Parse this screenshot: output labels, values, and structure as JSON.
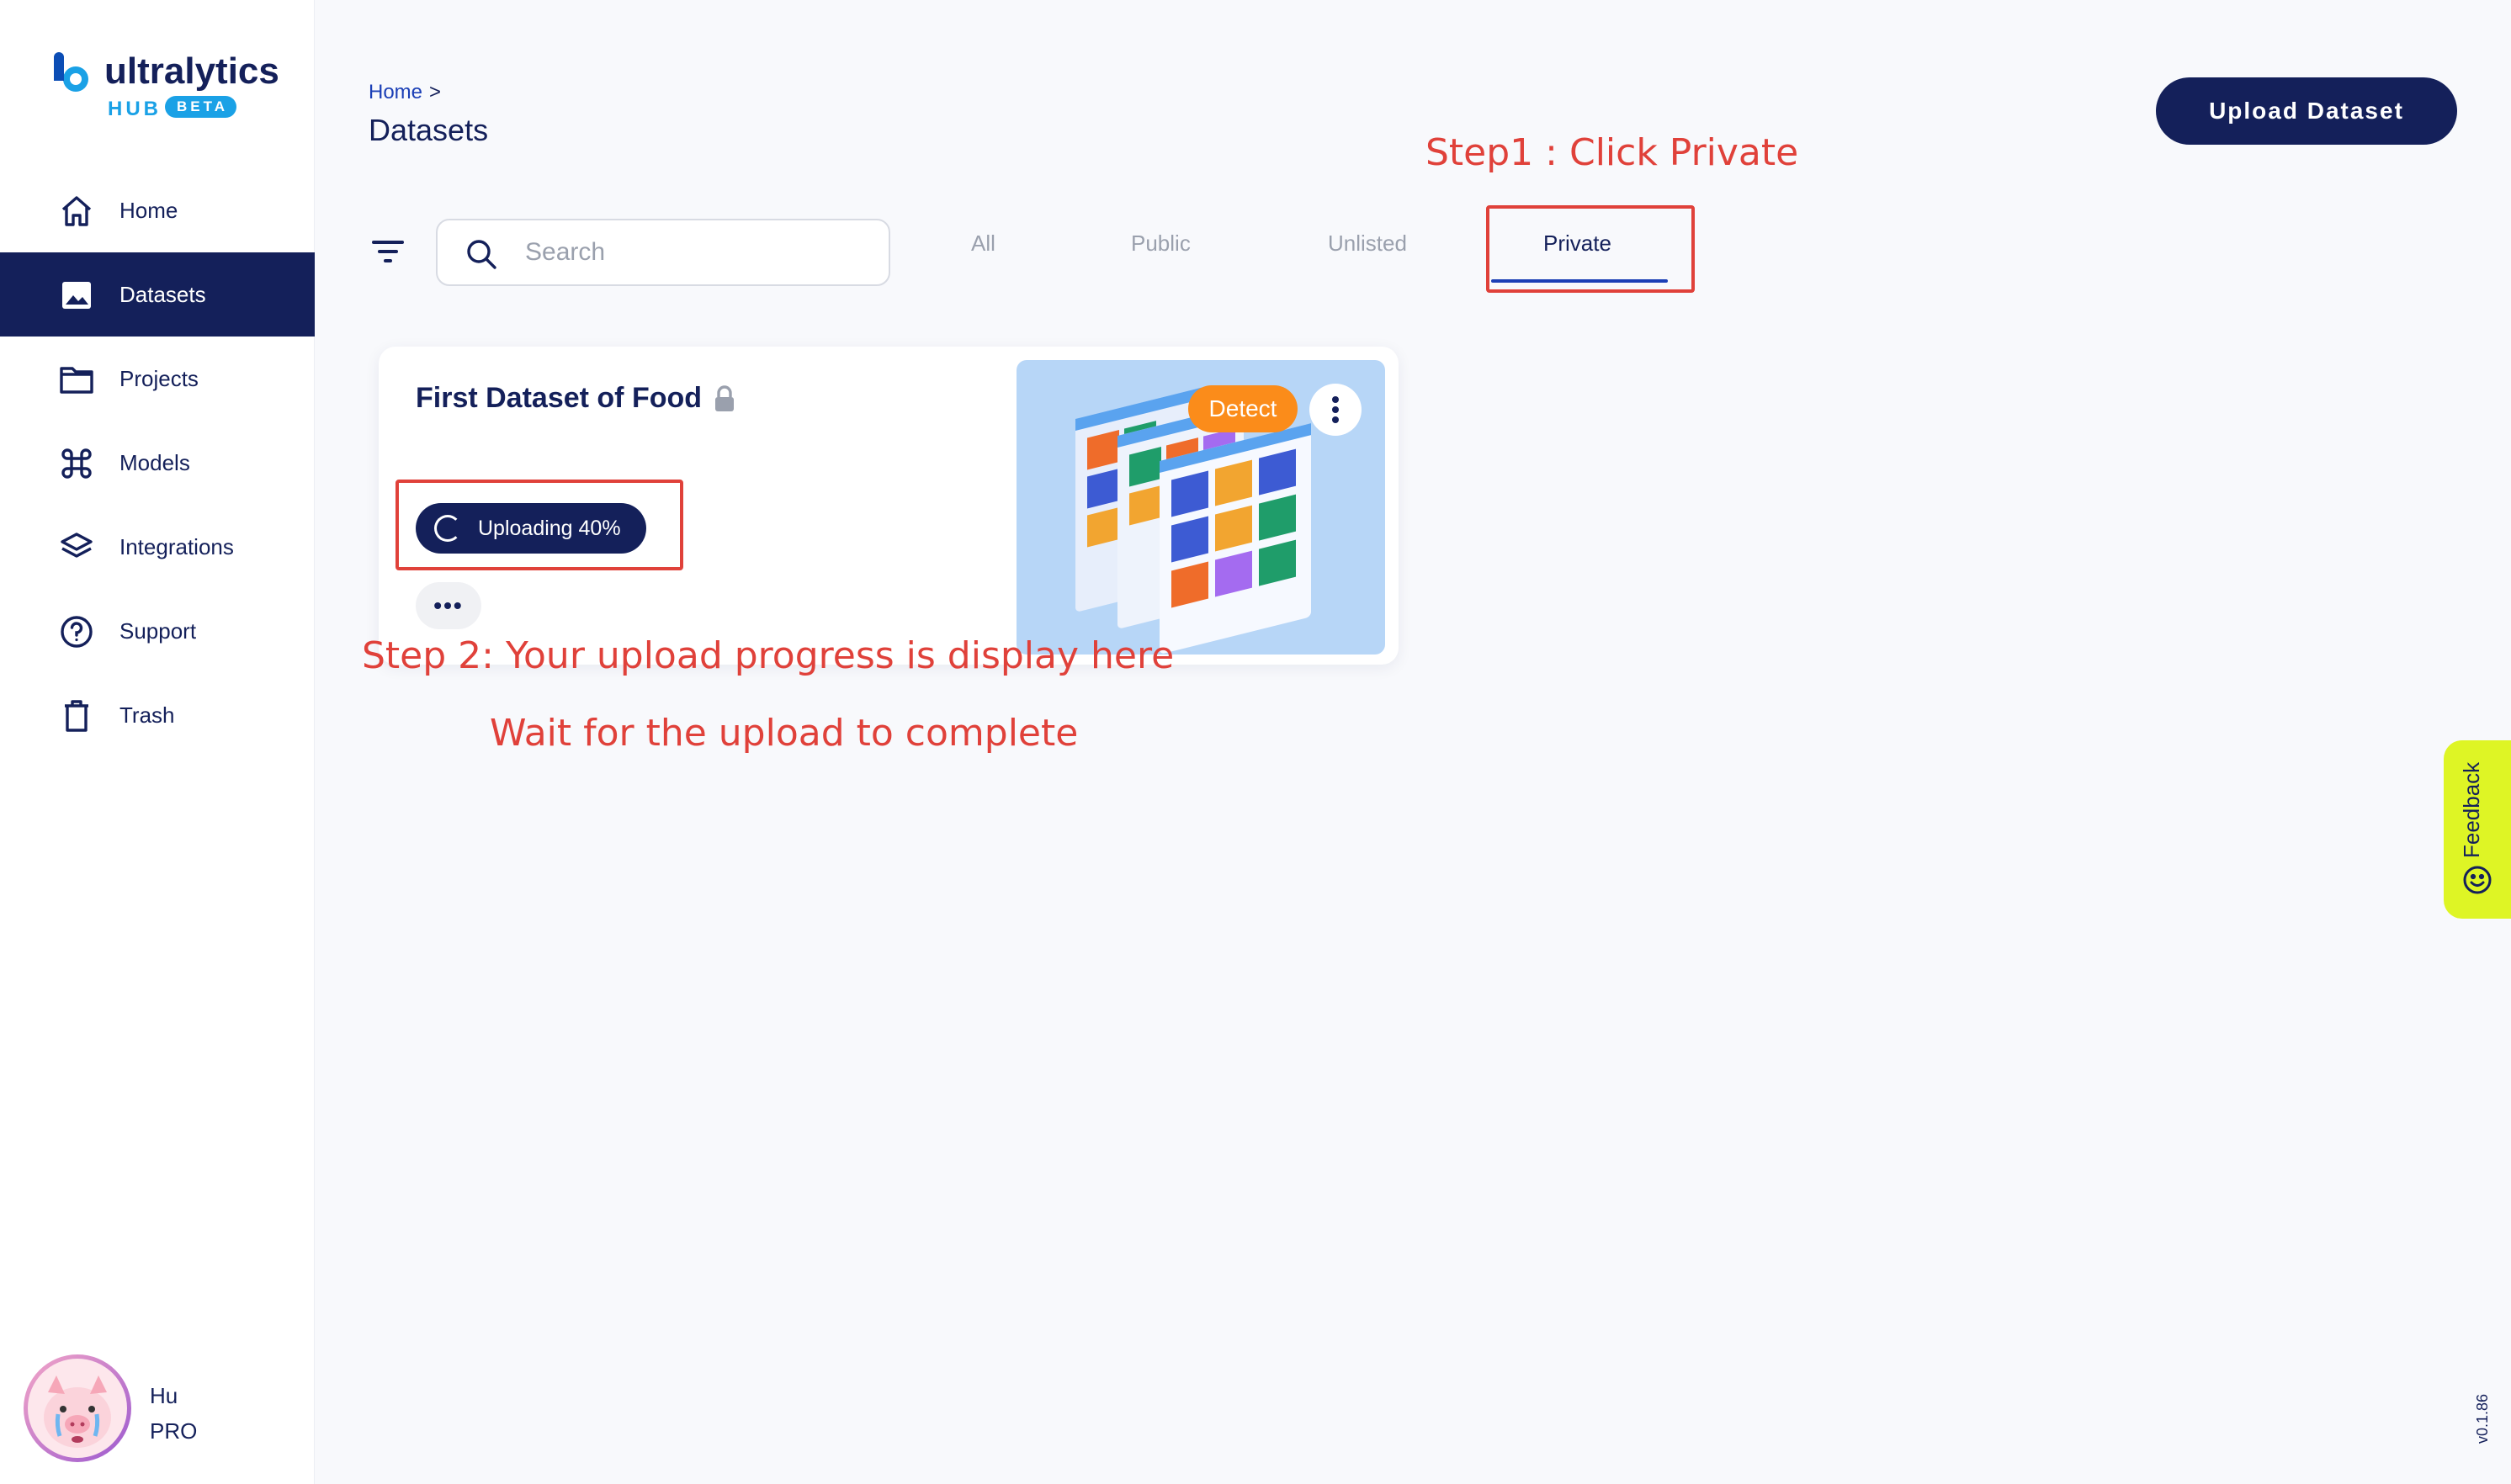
{
  "brand": {
    "name": "ultralytics",
    "hub": "HUB",
    "beta": "BETA"
  },
  "sidebar": {
    "items": [
      {
        "label": "Home",
        "icon": "home-icon"
      },
      {
        "label": "Datasets",
        "icon": "image-icon",
        "active": true
      },
      {
        "label": "Projects",
        "icon": "folder-icon"
      },
      {
        "label": "Models",
        "icon": "command-icon"
      },
      {
        "label": "Integrations",
        "icon": "layers-icon"
      },
      {
        "label": "Support",
        "icon": "help-circle-icon"
      },
      {
        "label": "Trash",
        "icon": "trash-icon"
      }
    ]
  },
  "user": {
    "name": "Hu",
    "plan": "PRO"
  },
  "header": {
    "breadcrumb": "Home",
    "breadcrumb_sep": ">",
    "title": "Datasets",
    "upload_label": "Upload Dataset"
  },
  "search": {
    "placeholder": "Search",
    "value": ""
  },
  "tabs": [
    {
      "label": "All"
    },
    {
      "label": "Public"
    },
    {
      "label": "Unlisted"
    },
    {
      "label": "Private",
      "active": true
    }
  ],
  "dataset_card": {
    "title": "First Dataset of Food",
    "status": "Uploading 40%",
    "progress": 0.4,
    "task_badge": "Detect",
    "more_label": "•••"
  },
  "annotations": {
    "step1": "Step1 : Click Private",
    "step2": "Step 2: Your upload progress is display here",
    "step2_note": "Wait for the upload to complete"
  },
  "feedback": {
    "label": "Feedback"
  },
  "version": "v0.1.86",
  "colors": {
    "navy": "#14205a",
    "accent_blue": "#1b3fb6",
    "orange": "#fb8c1a",
    "feedback_yellow": "#def525",
    "annotation_red": "#e0413a"
  }
}
